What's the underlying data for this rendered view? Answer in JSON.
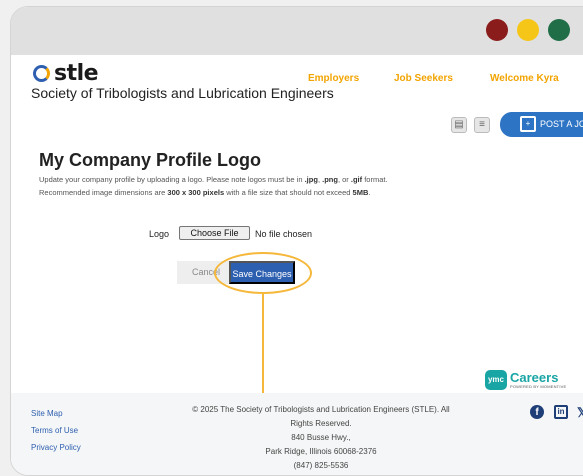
{
  "window": {
    "controls": [
      "close",
      "minimize",
      "maximize"
    ],
    "colors": {
      "close": "#8b1c1c",
      "minimize": "#f5c518",
      "maximize": "#1f6e47"
    }
  },
  "header": {
    "logo_text": "stle",
    "org_name": "Society of Tribologists and Lubrication Engineers",
    "nav": {
      "employers": "Employers",
      "job_seekers": "Job Seekers",
      "welcome": "Welcome Kyra"
    },
    "accent_color": "#f2a400"
  },
  "toolbar": {
    "icons": [
      "document-search-icon",
      "list-icon"
    ],
    "post_job_label": "POST A JOB"
  },
  "main": {
    "title": "My Company Profile Logo",
    "desc_line1_a": "Update your company profile by uploading a logo. Please note logos must be in ",
    "desc_formats_1": ".jpg",
    "desc_sep_1": ", ",
    "desc_formats_2": ".png",
    "desc_sep_2": ", or ",
    "desc_formats_3": ".gif",
    "desc_line1_b": " format.",
    "desc_line2_a": "Recommended image dimensions are ",
    "desc_dims": "300 x 300 pixels",
    "desc_line2_b": " with a file size that should not exceed ",
    "desc_size": "5MB",
    "desc_line2_c": ".",
    "upload": {
      "label": "Logo",
      "button": "Choose File",
      "status": "No file chosen"
    },
    "cancel_label": "Cancel",
    "save_label": "Save Changes"
  },
  "branding": {
    "badge": "ymc",
    "title": "Careers",
    "subtitle": "POWERED BY MOMENTIVE"
  },
  "footer": {
    "links": [
      "Site Map",
      "Terms of Use",
      "Privacy Policy"
    ],
    "copyright_1": "© 2025 The Society of Tribologists and Lubrication Engineers (STLE). All",
    "copyright_2": "Rights Reserved.",
    "address_1": "840 Busse Hwy.,",
    "address_2": "Park Ridge, Illinois 60068-2376",
    "phone": "(847) 825-5536",
    "social": [
      "facebook-icon",
      "linkedin-icon",
      "x-icon"
    ]
  }
}
